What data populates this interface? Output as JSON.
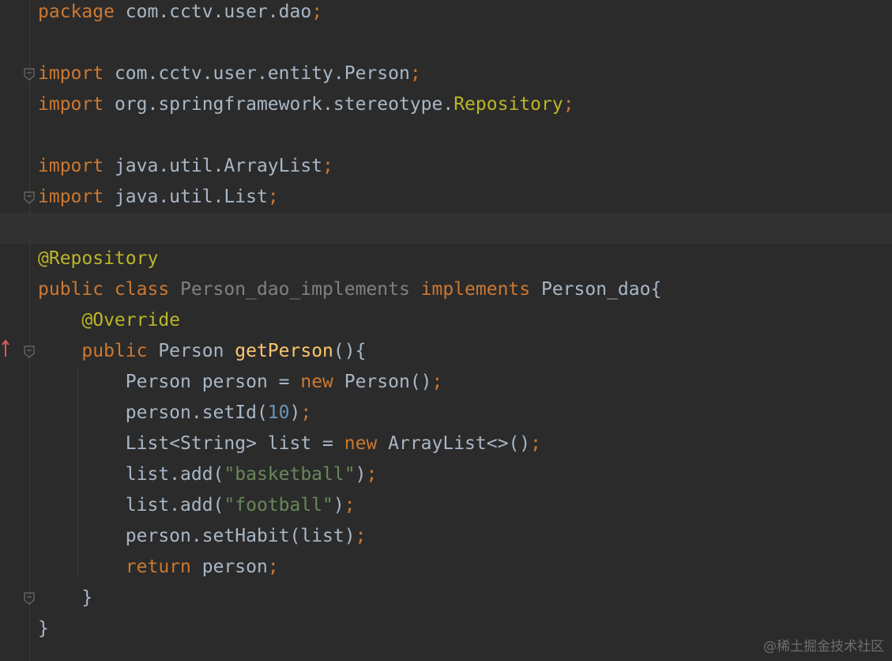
{
  "editor": {
    "lines": [
      [
        {
          "c": "kw",
          "t": "package "
        },
        {
          "c": "pl",
          "t": "com.cctv.user.dao"
        },
        {
          "c": "kw",
          "t": ";"
        }
      ],
      [],
      [
        {
          "c": "kw",
          "t": "import "
        },
        {
          "c": "pl",
          "t": "com.cctv.user.entity.Person"
        },
        {
          "c": "kw",
          "t": ";"
        }
      ],
      [
        {
          "c": "kw",
          "t": "import "
        },
        {
          "c": "pl",
          "t": "org.springframework.stereotype."
        },
        {
          "c": "an",
          "t": "Repository"
        },
        {
          "c": "kw",
          "t": ";"
        }
      ],
      [],
      [
        {
          "c": "kw",
          "t": "import "
        },
        {
          "c": "pl",
          "t": "java.util.ArrayList"
        },
        {
          "c": "kw",
          "t": ";"
        }
      ],
      [
        {
          "c": "kw",
          "t": "import "
        },
        {
          "c": "pl",
          "t": "java.util.List"
        },
        {
          "c": "kw",
          "t": ";"
        }
      ],
      [],
      [
        {
          "c": "an",
          "t": "@Repository"
        }
      ],
      [
        {
          "c": "kw",
          "t": "public class "
        },
        {
          "c": "gr",
          "t": "Person_dao_implements "
        },
        {
          "c": "kw",
          "t": "implements "
        },
        {
          "c": "pl",
          "t": "Person_dao{"
        }
      ],
      [
        {
          "c": "pl",
          "t": "    "
        },
        {
          "c": "an",
          "t": "@Override"
        }
      ],
      [
        {
          "c": "pl",
          "t": "    "
        },
        {
          "c": "kw",
          "t": "public "
        },
        {
          "c": "pl",
          "t": "Person "
        },
        {
          "c": "fn",
          "t": "getPerson"
        },
        {
          "c": "pl",
          "t": "(){"
        }
      ],
      [
        {
          "c": "pl",
          "t": "        Person person = "
        },
        {
          "c": "kw",
          "t": "new "
        },
        {
          "c": "pl",
          "t": "Person()"
        },
        {
          "c": "kw",
          "t": ";"
        }
      ],
      [
        {
          "c": "pl",
          "t": "        person.setId("
        },
        {
          "c": "num",
          "t": "10"
        },
        {
          "c": "pl",
          "t": ")"
        },
        {
          "c": "kw",
          "t": ";"
        }
      ],
      [
        {
          "c": "pl",
          "t": "        List<String> list = "
        },
        {
          "c": "kw",
          "t": "new "
        },
        {
          "c": "pl",
          "t": "ArrayList<>()"
        },
        {
          "c": "kw",
          "t": ";"
        }
      ],
      [
        {
          "c": "pl",
          "t": "        list.add("
        },
        {
          "c": "str",
          "t": "\"basketball\""
        },
        {
          "c": "pl",
          "t": ")"
        },
        {
          "c": "kw",
          "t": ";"
        }
      ],
      [
        {
          "c": "pl",
          "t": "        list.add("
        },
        {
          "c": "str",
          "t": "\"football\""
        },
        {
          "c": "pl",
          "t": ")"
        },
        {
          "c": "kw",
          "t": ";"
        }
      ],
      [
        {
          "c": "pl",
          "t": "        person.setHabit(list)"
        },
        {
          "c": "kw",
          "t": ";"
        }
      ],
      [
        {
          "c": "pl",
          "t": "        "
        },
        {
          "c": "kw",
          "t": "return "
        },
        {
          "c": "pl",
          "t": "person"
        },
        {
          "c": "kw",
          "t": ";"
        }
      ],
      [
        {
          "c": "pl",
          "t": "    }"
        }
      ],
      [
        {
          "c": "pl",
          "t": "}"
        }
      ]
    ],
    "current_line": 7,
    "fold_lines": [
      2,
      6,
      11,
      19
    ]
  },
  "watermark": "@稀土掘金技术社区",
  "colors": {
    "background": "#2b2b2b",
    "keyword": "#cc7832",
    "plain": "#a9b7c6",
    "annotation": "#bbb529",
    "string": "#6a8759",
    "number": "#6897bb",
    "method": "#ffc66d",
    "unused": "#808080",
    "override_marker": "#e05555"
  }
}
